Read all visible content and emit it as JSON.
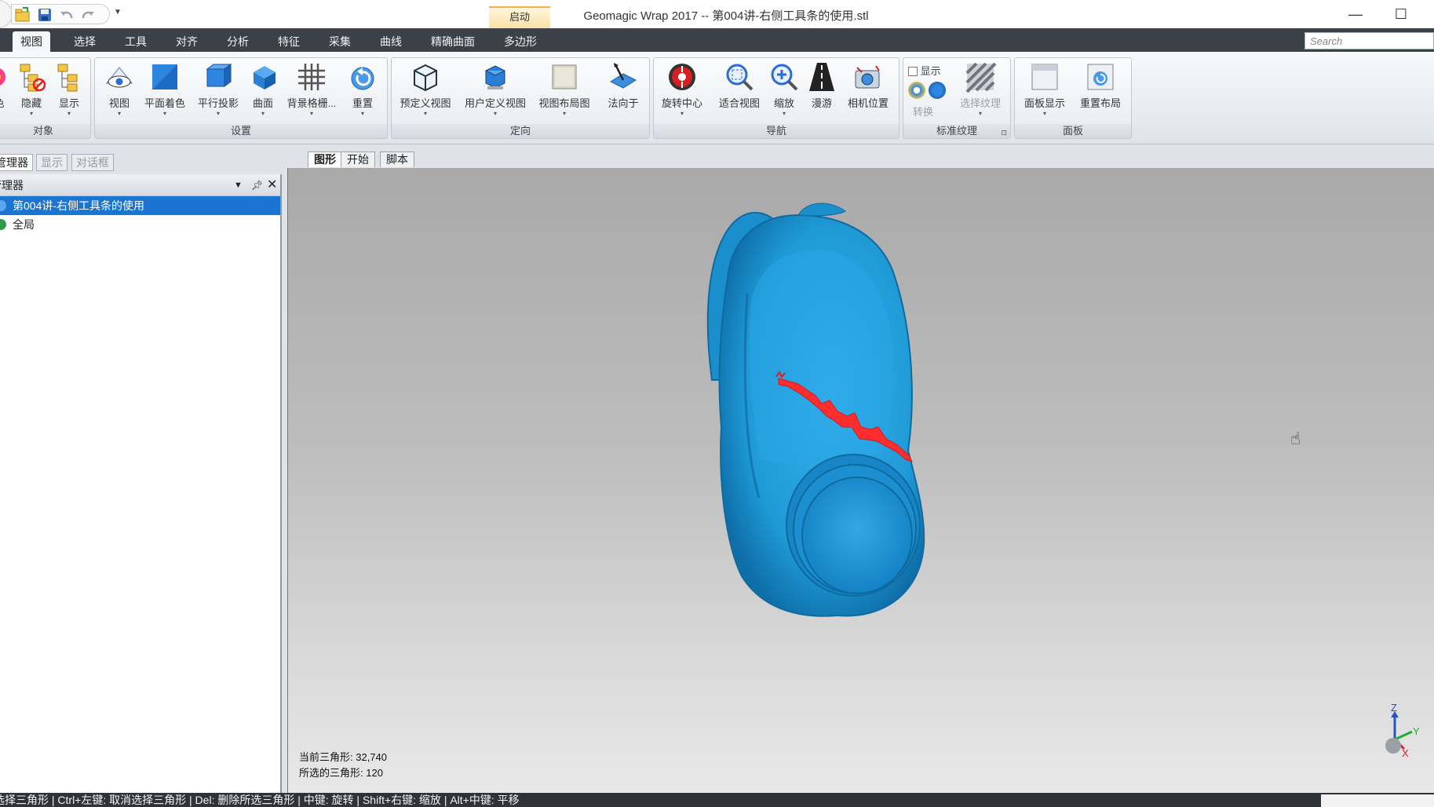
{
  "window": {
    "title": "Geomagic Wrap 2017 -- 第004讲-右侧工具条的使用.stl",
    "context_tab": "启动",
    "minimize_label": "—",
    "maximize_label": "☐"
  },
  "ribbon_tabs": [
    "视图",
    "选择",
    "工具",
    "对齐",
    "分析",
    "特征",
    "采集",
    "曲线",
    "精确曲面",
    "多边形"
  ],
  "active_ribbon_tab": "视图",
  "search": {
    "placeholder": "Search"
  },
  "groups": {
    "object": {
      "label": "对象",
      "tools": [
        "色",
        "隐藏",
        "显示"
      ]
    },
    "settings": {
      "label": "设置",
      "tools": [
        "视图",
        "平面着色",
        "平行投影",
        "曲面",
        "背景格栅...",
        "重置"
      ]
    },
    "orient": {
      "label": "定向",
      "tools": [
        "预定义视图",
        "用户定义视图",
        "视图布局图",
        "法向于"
      ]
    },
    "nav": {
      "label": "导航",
      "tools": [
        "旋转中心",
        "适合视图",
        "缩放",
        "漫游",
        "相机位置"
      ]
    },
    "texture": {
      "label": "标准纹理",
      "show_label": "显示",
      "convert_label": "转换",
      "select_label": "选择纹理"
    },
    "panel": {
      "label": "面板",
      "tools": [
        "面板显示",
        "重置布局"
      ]
    }
  },
  "left_panel": {
    "tabs": [
      "管理器",
      "显示",
      "对话框"
    ],
    "header": "管理器",
    "tree": [
      {
        "label": "第004讲-右侧工具条的使用",
        "selected": true
      },
      {
        "label": "全局",
        "selected": false
      }
    ]
  },
  "doc_tabs": [
    "图形",
    "开始",
    "脚本"
  ],
  "viewport": {
    "current_triangles_label": "当前三角形:",
    "current_triangles": "32,740",
    "selected_triangles_label": "所选的三角形:",
    "selected_triangles": "120",
    "model_color": "#1e9ad6",
    "selection_color": "#ff2d2d",
    "axes": {
      "z": "Z",
      "y": "Y",
      "x": "X"
    }
  },
  "status_bar": "选择三角形 | Ctrl+左键: 取消选择三角形 | Del: 删除所选三角形 | 中键: 旋转 | Shift+右键: 缩放 | Alt+中键: 平移"
}
